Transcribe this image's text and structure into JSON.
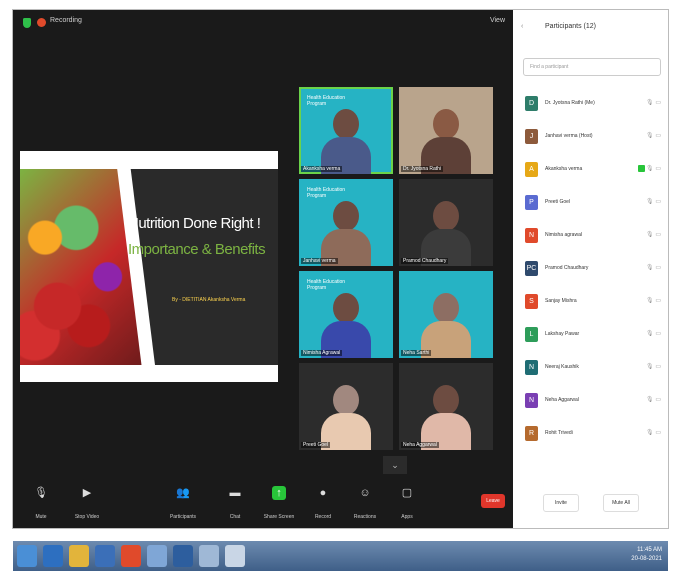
{
  "topbar": {
    "recording_label": "Recording",
    "view_label": "View"
  },
  "slide": {
    "title": "Nutrition Done Right !",
    "subtitle": "Importance & Benefits",
    "byline": "By - DIETITIAN Akanksha Verma"
  },
  "tiles": [
    {
      "name": "Akanksha verma",
      "style": "teal",
      "active": true
    },
    {
      "name": "Dr. Jyotsna Rathi",
      "style": "photo"
    },
    {
      "name": "Janhavi verma",
      "style": "teal"
    },
    {
      "name": "Pramod Chaudhary",
      "style": "photo"
    },
    {
      "name": "Nimisha Agrawal",
      "style": "teal"
    },
    {
      "name": "Neha Sarthi",
      "style": "teal"
    },
    {
      "name": "Preeti Goel",
      "style": "photo"
    },
    {
      "name": "Neha Aggarwal",
      "style": "photo"
    }
  ],
  "toolbar": {
    "mute": "Mute",
    "stop_video": "Stop Video",
    "participants": "Participants",
    "chat": "Chat",
    "share_screen": "Share Screen",
    "record": "Record",
    "reactions": "Reactions",
    "apps": "Apps",
    "end": "Leave"
  },
  "panel": {
    "title": "Participants (12)",
    "search_placeholder": "Find a participant",
    "participants": [
      {
        "name": "Dr. Jyotsna Rathi (Me)",
        "initial": "D",
        "color": "#2e7d6a",
        "icons": "🎙 ▭"
      },
      {
        "name": "Janhavi verma (Host)",
        "initial": "J",
        "color": "#8d5a3b",
        "icons": "🎙 ▭"
      },
      {
        "name": "Akanksha verma",
        "initial": "A",
        "color": "#e6a817",
        "icons": "🎙 ▭",
        "sharing": true
      },
      {
        "name": "Preeti Goel",
        "initial": "P",
        "color": "#5a6bd1",
        "icons": "🎙 ▭"
      },
      {
        "name": "Nimisha agrawal",
        "initial": "N",
        "color": "#e04a2b",
        "icons": "🎙 ▭"
      },
      {
        "name": "Pramod Chaudhary",
        "initial": "PC",
        "color": "#2f4a6d",
        "icons": "🎙 ▭"
      },
      {
        "name": "Sanjay Mishra",
        "initial": "S",
        "color": "#e04a2b",
        "icons": "🎙 ▭"
      },
      {
        "name": "Lakshay Pawar",
        "initial": "L",
        "color": "#2e9d5a",
        "icons": "🎙 ▭"
      },
      {
        "name": "Neeraj Kaushik",
        "initial": "N",
        "color": "#1f6d74",
        "icons": "🎙 ▭"
      },
      {
        "name": "Neha Aggarwal",
        "initial": "N",
        "color": "#7a3fb3",
        "icons": "🎙 ▭"
      },
      {
        "name": "Rohit Trivedi",
        "initial": "R",
        "color": "#b56a2e",
        "icons": "🎙 ▭"
      }
    ],
    "invite_label": "Invite",
    "mute_all_label": "Mute All"
  },
  "taskbar": {
    "clock_time": "11:45 AM",
    "clock_date": "20-08-2021"
  }
}
